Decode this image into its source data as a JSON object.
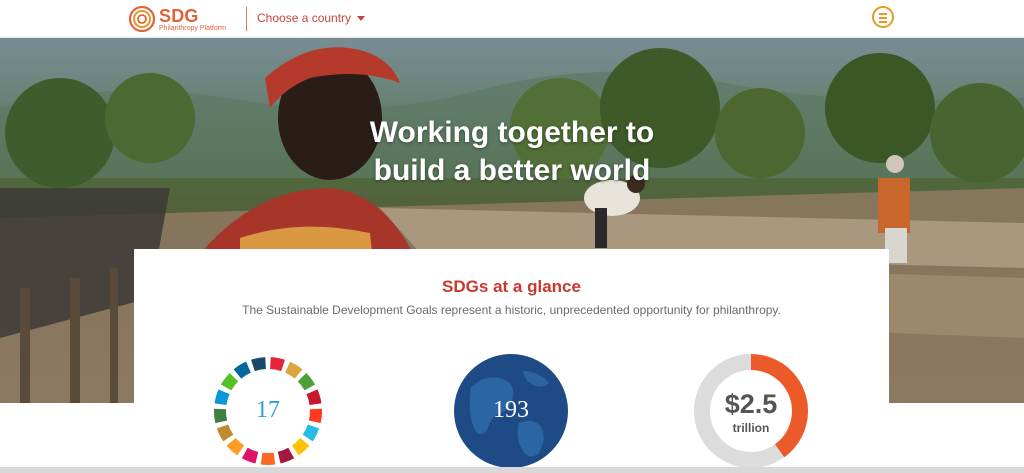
{
  "header": {
    "logo_title": "SDG",
    "logo_subtitle": "Philanthropy Platform",
    "country_select_label": "Choose a country",
    "brand_color": "#e2633a",
    "menu_icon": "hamburger-menu-icon"
  },
  "hero": {
    "headline_line1": "Working together to",
    "headline_line2": "build a better world"
  },
  "glance": {
    "title": "SDGs at a glance",
    "description": "The Sustainable Development Goals represent a historic, unprecedented opportunity for philanthropy.",
    "title_color": "#c9392e",
    "stats": [
      {
        "value": "17",
        "icon": "sdg-color-wheel-icon"
      },
      {
        "value": "193",
        "icon": "globe-icon"
      },
      {
        "value": "$2.5",
        "unit": "trillion",
        "icon": "donut-progress-icon",
        "fill_fraction": 0.4
      }
    ]
  }
}
